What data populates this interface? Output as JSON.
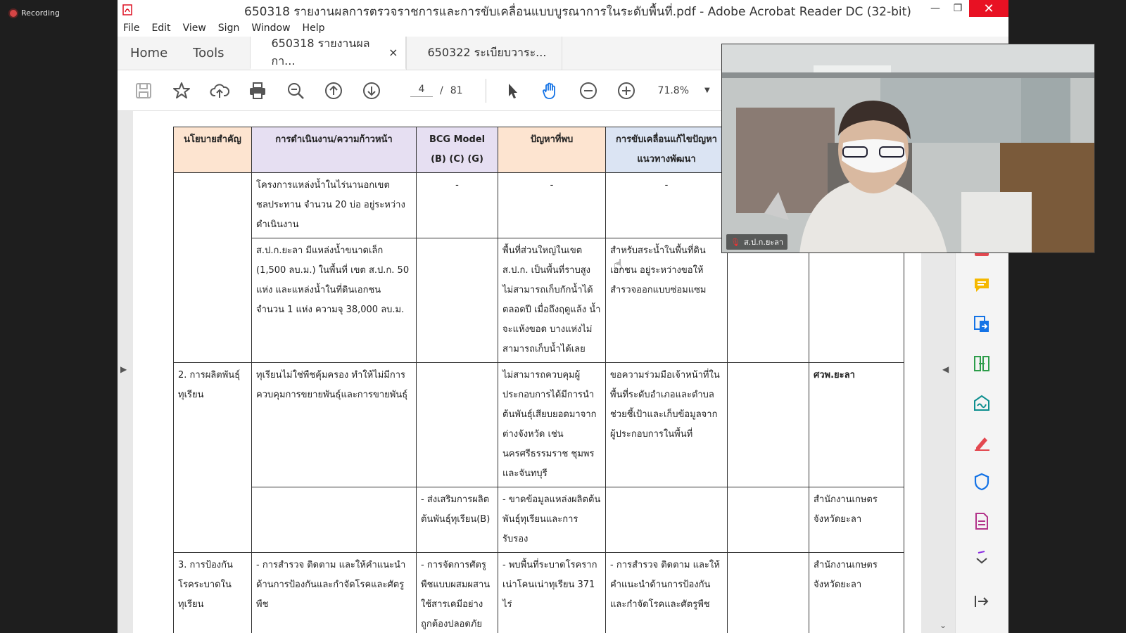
{
  "recording": {
    "label": "Recording"
  },
  "window": {
    "title": "650318 รายงานผลการตรวจราชการและการขับเคลื่อนแบบบูรณาการในระดับพื้นที่.pdf - Adobe Acrobat Reader DC (32-bit)",
    "controls": {
      "minimize": "—",
      "restore": "❐",
      "close": "✕"
    }
  },
  "menu": [
    "File",
    "Edit",
    "View",
    "Sign",
    "Window",
    "Help"
  ],
  "tabs": {
    "home": "Home",
    "tools": "Tools",
    "docs": [
      {
        "label": "650318 รายงานผลกา...",
        "close": "×"
      },
      {
        "label": "650322 ระเบียบวาระ..."
      }
    ]
  },
  "toolbar": {
    "page_current": "4",
    "page_sep": "/",
    "page_total": "81",
    "zoom": "71.8%"
  },
  "table": {
    "headers": [
      "นโยบายสำคัญ",
      "การดำเนินงาน/ความก้าวหน้า",
      "BCG Model (B) (C) (G)",
      "ปัญหาที่พบ",
      "การขับเคลื่อนแก้ไขปัญหา แนวทางพัฒนา",
      "",
      ""
    ],
    "rows": [
      [
        "",
        "โครงการแหล่งน้ำในไร่นานอกเขตชลประทาน จำนวน 20 บ่อ อยู่ระหว่างดำเนินงาน",
        "-",
        "-",
        "-",
        "",
        ""
      ],
      [
        "",
        "ส.ป.ก.ยะลา มีแหล่งน้ำขนาดเล็ก (1,500 ลบ.ม.) ในพื้นที่ เขต ส.ป.ก. 50 แห่ง และแหล่งน้ำในที่ดินเอกชน จำนวน 1 แห่ง ความจุ 38,000 ลบ.ม.",
        "",
        "พื้นที่ส่วนใหญ่ในเขต ส.ป.ก. เป็นพื้นที่ราบสูง ไม่สามารถเก็บกักน้ำได้ตลอดปี เมื่อถึงฤดูแล้ง น้ำจะแห้งขอด บางแห่งไม่สามารถเก็บน้ำได้เลย",
        "สำหรับสระน้ำในพื้นที่ดินเอกชน อยู่ระหว่างขอให้สำรวจออกแบบซ่อมแซม",
        "",
        ""
      ],
      [
        "2. การผลิตพันธุ์ทุเรียน",
        "ทุเรียนไม่ใช่พืชคุ้มครอง ทำให้ไม่มีการควบคุมการขยายพันธุ์และการขายพันธุ์",
        "",
        "ไม่สามารถควบคุมผู้ประกอบการได้มีการนำต้นพันธุ์เสียบยอดมาจากต่างจังหวัด เช่น นครศรีธรรมราช ชุมพร และจันทบุรี",
        "ขอความร่วมมือเจ้าหน้าที่ในพื้นที่ระดับอำเภอและตำบลช่วยชี้เป้าและเก็บข้อมูลจากผู้ประกอบการในพื้นที่",
        "",
        "ศวพ.ยะลา"
      ],
      [
        "",
        "",
        "- ส่งเสริมการผลิตต้นพันธุ์ทุเรียน(B)",
        "- ขาดข้อมูลแหล่งผลิตต้นพันธุ์ทุเรียนและการรับรอง",
        "",
        "",
        "สำนักงานเกษตรจังหวัดยะลา"
      ],
      [
        "3. การป้องกันโรคระบาดในทุเรียน",
        "- การสำรวจ ติดตาม และให้คำแนะนำด้านการป้องกันและกำจัดโรคและศัตรูพืช",
        "- การจัดการศัตรูพืชแบบผสมผสาน ใช้สารเคมีอย่างถูกต้องปลอดภัย ใช้สารชีว",
        "- พบพื้นที่ระบาดโรครากเน่าโคนเน่าทุเรียน 371 ไร่",
        "- การสำรวจ ติดตาม และให้คำแนะนำด้านการป้องกันและกำจัดโรคและศัตรูพืช",
        "",
        "สำนักงานเกษตรจังหวัดยะลา"
      ]
    ]
  },
  "video": {
    "participant": "ส.ป.ก.ยะลา"
  },
  "icons": {
    "save": "save-icon",
    "bookmark": "star-icon",
    "upload": "cloud-upload-icon",
    "print": "printer-icon",
    "zoom_search": "zoom-search-icon",
    "prev": "arrow-up-circle-icon",
    "next": "arrow-down-circle-icon",
    "select": "pointer-icon",
    "hand": "hand-icon",
    "zoom_out": "minus-circle-icon",
    "zoom_in": "plus-circle-icon"
  },
  "colors": {
    "close_red": "#e81123",
    "header_orange": "#fde4d0",
    "header_lavender": "#e6dff2",
    "header_blue": "#dbe4f3"
  }
}
